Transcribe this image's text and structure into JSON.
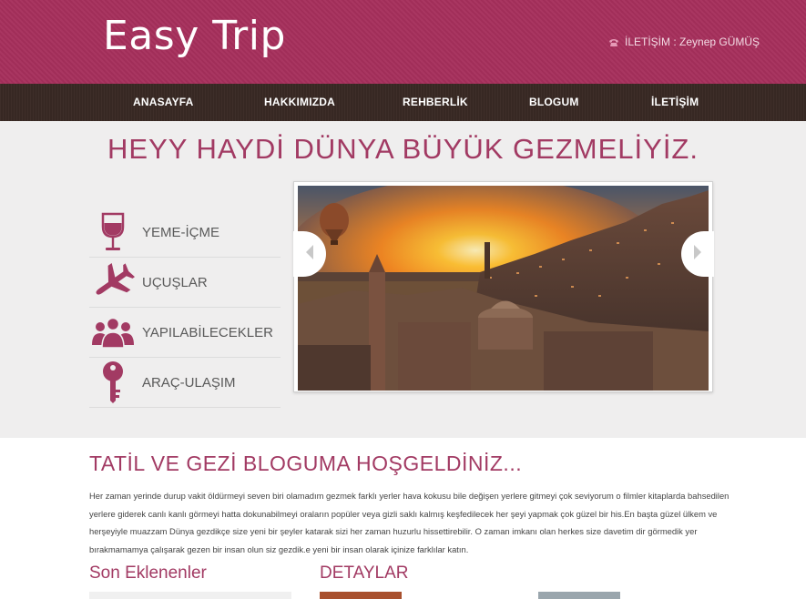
{
  "header": {
    "logo": "Easy Trip",
    "contact": "İLETİŞİM : Zeynep GÜMÜŞ",
    "contact_icon": "phone-icon"
  },
  "nav": {
    "items": [
      {
        "label": "ANASAYFA"
      },
      {
        "label": "HAKKIMIZDA"
      },
      {
        "label": "REHBERLİK"
      },
      {
        "label": "BLOGUM"
      },
      {
        "label": "İLETİŞİM"
      }
    ]
  },
  "hero": {
    "title": "HEYY HAYDİ DÜNYA BÜYÜK GEZMELİYİZ.",
    "features": [
      {
        "label": "YEME-İÇME",
        "icon": "wine-glass-icon"
      },
      {
        "label": "UÇUŞLAR",
        "icon": "airplane-icon"
      },
      {
        "label": "YAPILABİLECEKLER",
        "icon": "people-icon"
      },
      {
        "label": "ARAÇ-ULAŞIM",
        "icon": "key-icon"
      }
    ],
    "slider": {
      "prev_icon": "chevron-left-icon",
      "next_icon": "chevron-right-icon"
    }
  },
  "main": {
    "welcome_title": "TATİL VE GEZİ BLOGUMA HOŞGELDİNİZ...",
    "intro": "Her zaman yerinde durup vakit öldürmeyi seven biri olamadım gezmek farklı yerler hava kokusu bile değişen yerlere gitmeyi çok seviyorum o filmler kitaplarda bahsedilen yerlere giderek canlı kanlı görmeyi hatta dokunabilmeyi oraların popüler veya gizli saklı kalmış keşfedilecek her şeyi yapmak çok güzel bir his.En başta güzel ülkem ve herşeyiyle muazzam Dünya gezdikçe size yeni bir şeyler katarak sizi her zaman huzurlu hissettirebilir. O zaman imkanı olan herkes size davetim dir görmedik yer bırakmamamya çalışarak gezen bir insan olun siz gezdik.e yeni bir insan olarak içinize farklılar katın.",
    "recent_title": "Son Eklenenler",
    "details_title": "DETAYLAR"
  },
  "colors": {
    "brand": "#a62f5c",
    "nav_bg": "#3a2a25",
    "accent_text": "#a23a63",
    "hero_bg": "#efeeee"
  }
}
